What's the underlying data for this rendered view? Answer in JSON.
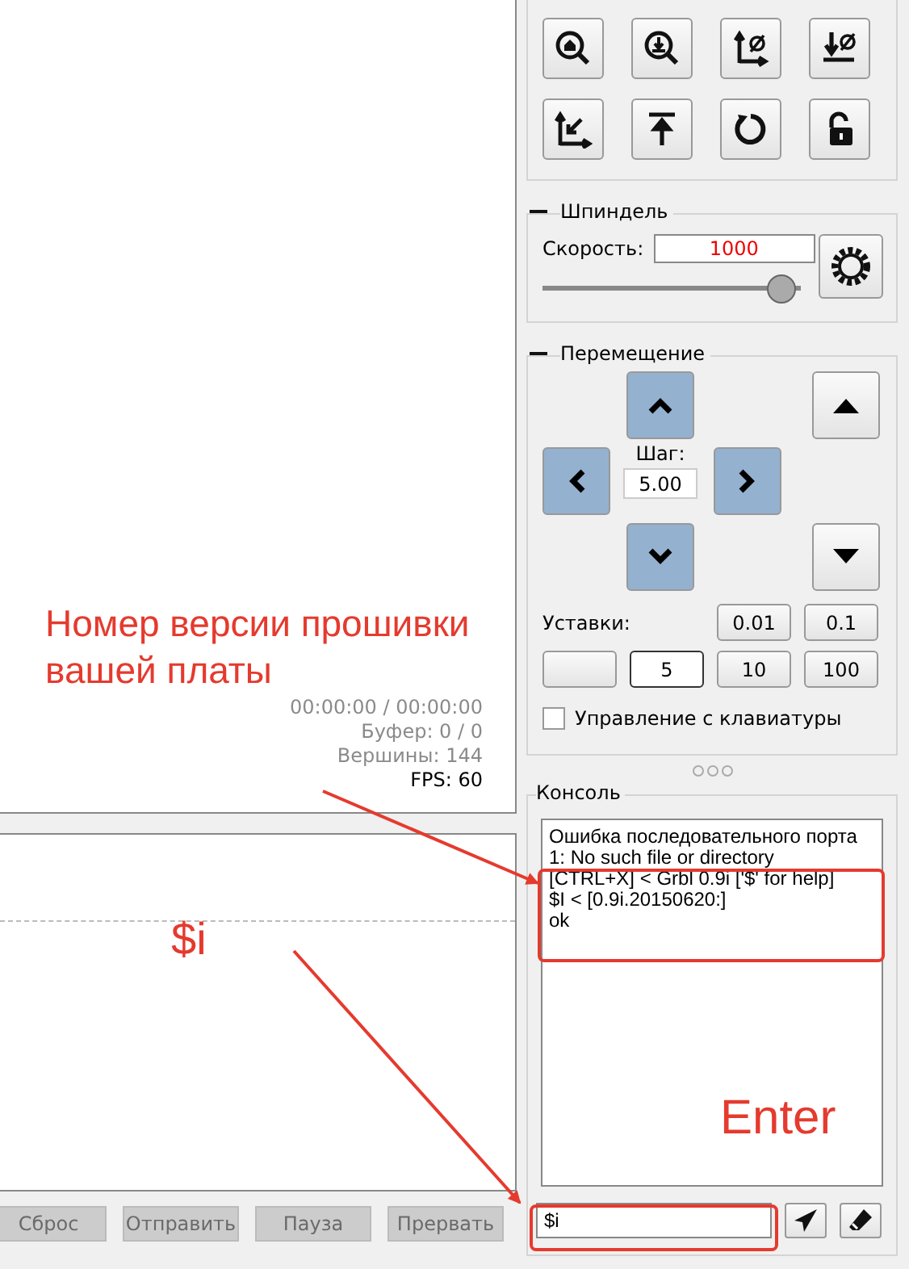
{
  "visualizer": {
    "info": [
      {
        "text": "00:00:00 / 00:00:00",
        "kind": "dim"
      },
      {
        "text": "Буфер: 0 / 0",
        "kind": "dim"
      },
      {
        "text": "Вершины: 144",
        "kind": "dim"
      },
      {
        "text": "FPS: 60",
        "kind": "normal"
      }
    ]
  },
  "program_buttons": [
    {
      "label": "Сброс",
      "disabled": true
    },
    {
      "label": "Отправить",
      "disabled": true
    },
    {
      "label": "Пауза",
      "disabled": true
    },
    {
      "label": "Прервать",
      "disabled": true
    }
  ],
  "spindle": {
    "title": "Шпиндель",
    "speed_label": "Скорость:",
    "speed_value": "1000",
    "level": 0.98
  },
  "jog": {
    "title": "Перемещение",
    "step_label": "Шаг:",
    "step_value": "5.00",
    "presets_label": "Уставки:",
    "presets_top": [
      {
        "label": "0.01",
        "selected": false
      },
      {
        "label": "0.1",
        "selected": false
      }
    ],
    "presets_bottom": [
      {
        "label": "5",
        "selected": true
      },
      {
        "label": "10",
        "selected": false
      },
      {
        "label": "100",
        "selected": false
      }
    ],
    "keyboard_control": {
      "label": "Управление с клавиатуры",
      "checked": false
    }
  },
  "console": {
    "title": "Консоль",
    "lines": [
      "Ошибка последовательного порта",
      "1: No such file or directory",
      "[CTRL+X] < Grbl 0.9i ['$' for help]",
      "$I < [0.9i.20150620:]",
      "ok"
    ],
    "command": "$i"
  },
  "annotations": {
    "callout": "Номер версии прошивки вашей платы",
    "typed_label": "$i",
    "key_label": "Enter"
  }
}
